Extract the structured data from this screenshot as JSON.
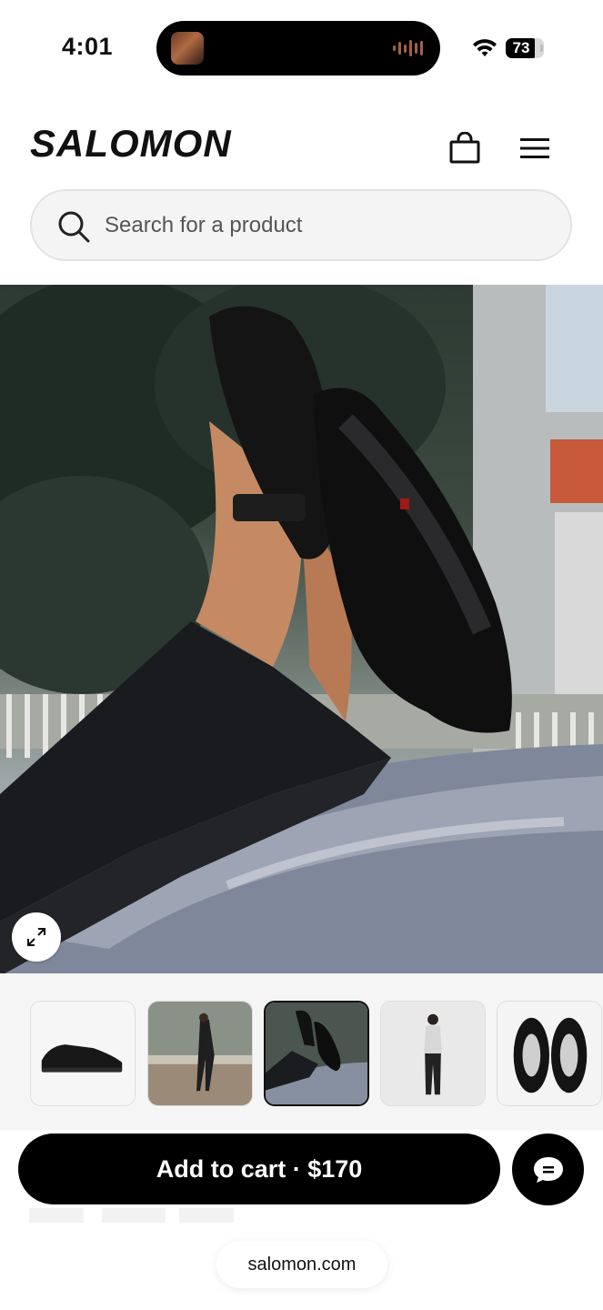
{
  "status_bar": {
    "time": "4:01",
    "battery_percent": "73",
    "icons": [
      "now-playing-art",
      "audio-waveform-icon",
      "wifi-icon",
      "battery-icon"
    ]
  },
  "header": {
    "logo_text": "SALOMON",
    "icons": [
      "shopping-bag-icon",
      "hamburger-menu-icon"
    ]
  },
  "search": {
    "placeholder": "Search for a product",
    "icon": "search-icon"
  },
  "gallery": {
    "expand_icon": "expand-icon",
    "selected_index": 2,
    "thumbnails": [
      {
        "name": "thumb-shoe-side"
      },
      {
        "name": "thumb-street-model"
      },
      {
        "name": "thumb-feet-up"
      },
      {
        "name": "thumb-studio-model"
      },
      {
        "name": "thumb-shoe-top"
      }
    ]
  },
  "purchase": {
    "add_to_cart_label": "Add to cart · $170",
    "chat_icon": "chat-bubble-icon"
  },
  "browser": {
    "url": "salomon.com"
  },
  "colors": {
    "primary": "#000000",
    "background": "#ffffff",
    "search_bg": "#f4f4f4",
    "thumb_strip_bg": "#f5f5f5"
  }
}
